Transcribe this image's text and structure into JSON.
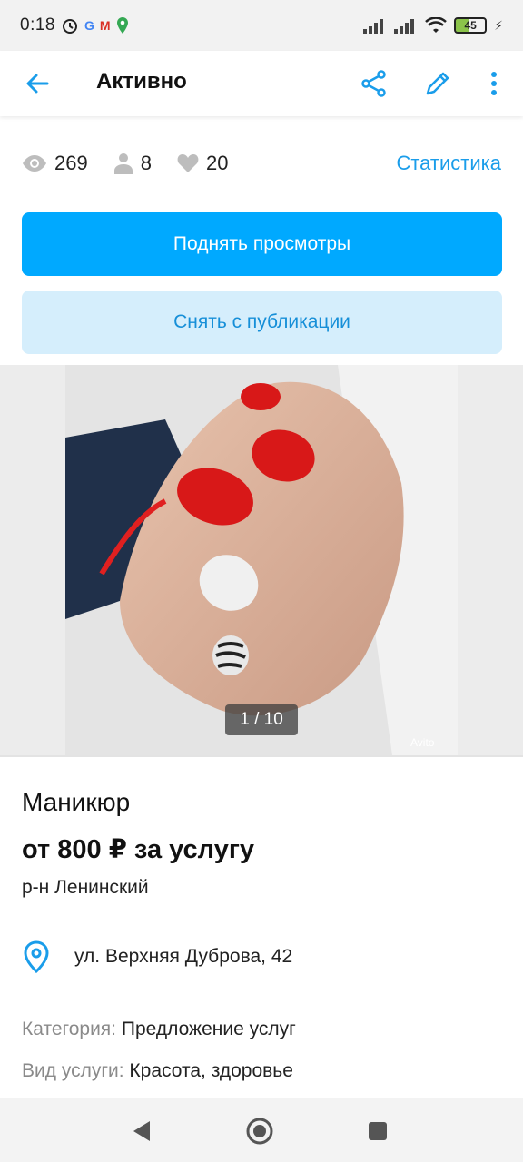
{
  "status_bar": {
    "time": "0:18",
    "notification_icons": [
      "alarm-icon",
      "google-icon",
      "gmail-icon",
      "maps-icon"
    ],
    "battery_level": "45"
  },
  "app_bar": {
    "title": "Активно",
    "back_icon": "arrow-left-icon",
    "share_icon": "share-icon",
    "edit_icon": "pencil-icon",
    "more_icon": "more-vertical-icon"
  },
  "stats": {
    "views": "269",
    "contacts": "8",
    "favorites": "20",
    "statistics_link": "Статистика"
  },
  "actions": {
    "raise_views": "Поднять просмотры",
    "unpublish": "Снять с публикации"
  },
  "gallery": {
    "counter": "1 / 10",
    "watermark": "Avito"
  },
  "listing": {
    "title": "Маникюр",
    "price": "от 800 ₽ за услугу",
    "district": "р-н Ленинский",
    "address": "ул. Верхняя Дуброва, 42",
    "params": [
      {
        "key": "Категория:",
        "value": "Предложение услуг"
      },
      {
        "key": "Вид услуги:",
        "value": "Красота, здоровье"
      }
    ]
  },
  "colors": {
    "accent": "#00a9ff",
    "link": "#1a9dea",
    "secondary_bg": "#d5eefc"
  }
}
